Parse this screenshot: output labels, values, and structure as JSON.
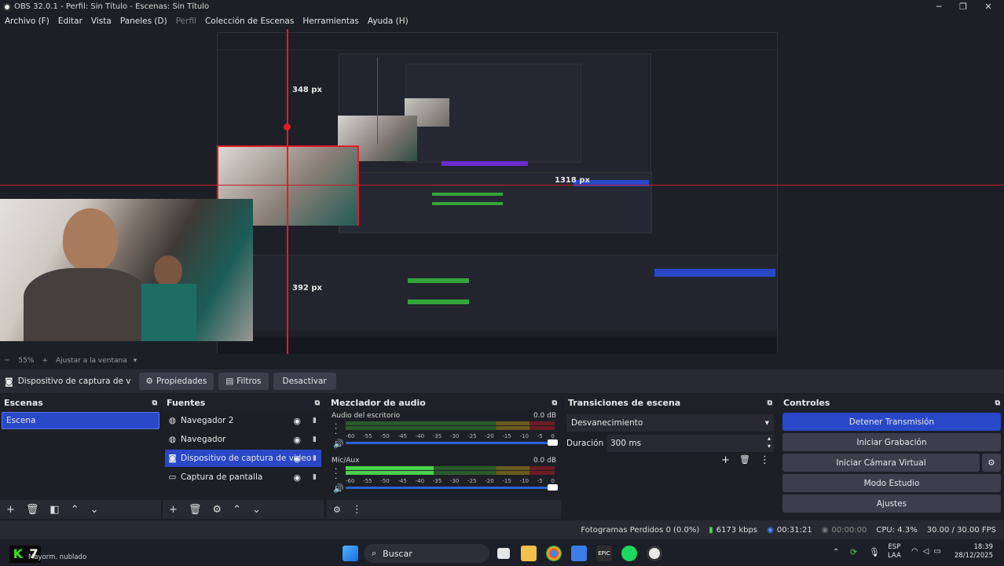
{
  "window": {
    "title": "OBS 32.0.1 - Perfil: Sin Título - Escenas: Sin Título",
    "minimize": "─",
    "maximize": "❐",
    "close": "✕"
  },
  "menu": [
    "Archivo (F)",
    "Editar",
    "Vista",
    "Paneles (D)",
    "Perfil",
    "Colección de Escenas",
    "Herramientas",
    "Ayuda (H)"
  ],
  "preview": {
    "label_vertical": "348 px",
    "label_horizontal": "1318 px",
    "label_side": "392 px",
    "zoom": "55%",
    "fit": "Ajustar a la ventana"
  },
  "source_toolbar": {
    "selected_source": "Dispositivo de captura de v",
    "properties": "Propiedades",
    "filters": "Filtros",
    "deactivate": "Desactivar"
  },
  "scenes": {
    "title": "Escenas",
    "items": [
      "Escena"
    ]
  },
  "sources": {
    "title": "Fuentes",
    "items": [
      "Navegador 2",
      "Navegador",
      "Dispositivo de captura de video",
      "Captura de pantalla"
    ]
  },
  "mixer": {
    "title": "Mezclador de audio",
    "channels": [
      {
        "name": "Audio del escritorio",
        "db": "0.0 dB",
        "level": 0.0
      },
      {
        "name": "Mic/Aux",
        "db": "0.0 dB",
        "level": 0.42
      }
    ],
    "ticks": [
      "-60",
      "-55",
      "-50",
      "-45",
      "-40",
      "-35",
      "-30",
      "-25",
      "-20",
      "-15",
      "-10",
      "-5",
      "0"
    ]
  },
  "transitions": {
    "title": "Transiciones de escena",
    "selected": "Desvanecimiento",
    "duration_label": "Duración",
    "duration_value": "300 ms"
  },
  "controls": {
    "title": "Controles",
    "stop_stream": "Detener Transmisión",
    "start_recording": "Iniciar Grabación",
    "start_virtual_cam": "Iniciar Cámara Virtual",
    "studio_mode": "Modo Estudio",
    "settings": "Ajustes"
  },
  "status": {
    "dropped": "Fotogramas Perdidos 0 (0.0%)",
    "bitrate": "6173 kbps",
    "stream_time": "00:31:21",
    "rec_time": "00:00:00",
    "cpu": "CPU: 4.3%",
    "fps": "30.00 / 30.00 FPS"
  },
  "taskbar": {
    "search": "Buscar",
    "weather": "Mayorm. nublado",
    "lang_top": "ESP",
    "lang_bottom": "LAA",
    "time": "18:39",
    "date": "28/12/2025",
    "badge": "7"
  }
}
